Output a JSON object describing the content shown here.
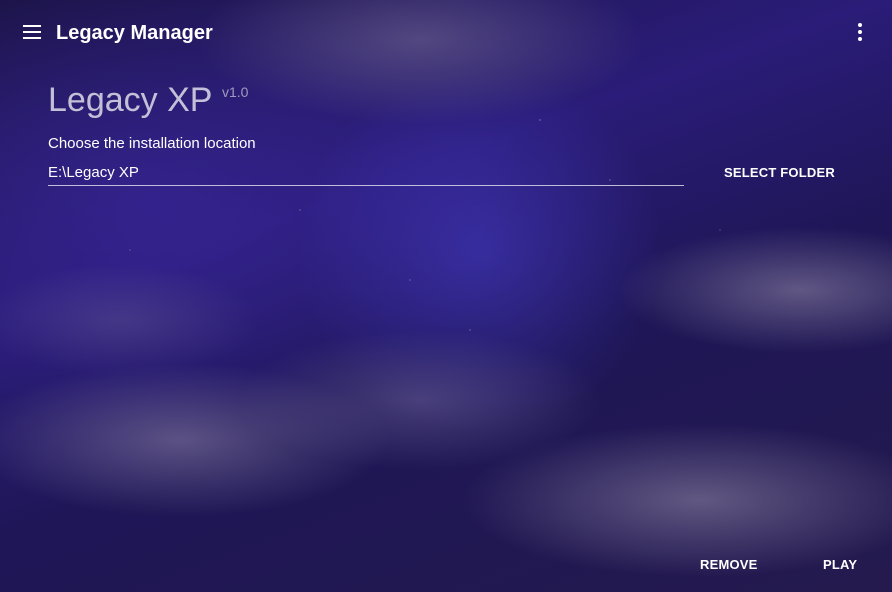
{
  "app": {
    "title": "Legacy Manager"
  },
  "icons": {
    "menu": "hamburger-menu-icon",
    "more": "more-vertical-icon"
  },
  "product": {
    "name": "Legacy XP",
    "version": "v1.0"
  },
  "install": {
    "label": "Choose the installation location",
    "path": "E:\\Legacy XP",
    "select_folder_label": "SELECT FOLDER"
  },
  "actions": {
    "remove_label": "REMOVE",
    "play_label": "PLAY"
  }
}
